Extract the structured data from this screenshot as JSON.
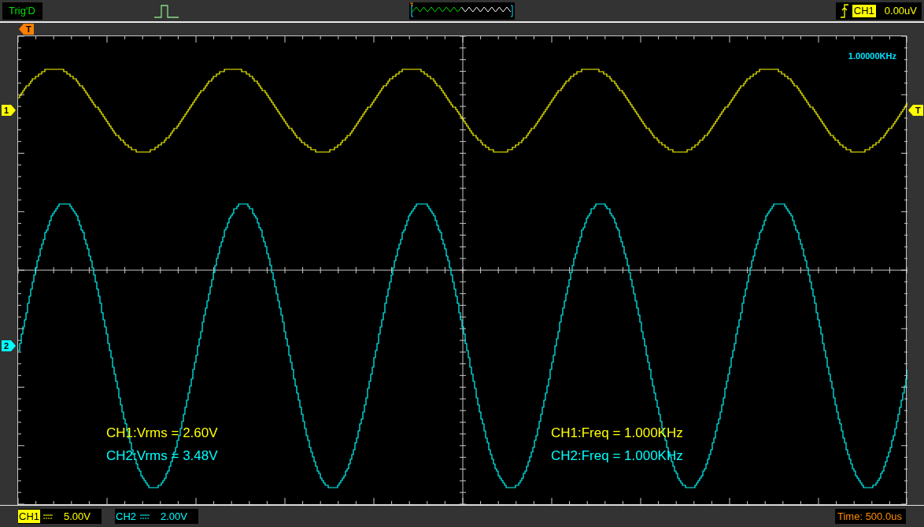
{
  "status": {
    "text": "Trig'D"
  },
  "trigger": {
    "position_marker": "T",
    "level_marker": "T",
    "source": "CH1",
    "level": "0.00uV"
  },
  "frequency_readout": "1.00000KHz",
  "channels": [
    {
      "name": "CH1",
      "marker": "1",
      "color": "#ffff00",
      "scale": "5.00V",
      "selected": true
    },
    {
      "name": "CH2",
      "marker": "2",
      "color": "#00ffff",
      "scale": "2.00V",
      "selected": false
    }
  ],
  "measurements": [
    {
      "text": "CH1:Vrms = 2.60V",
      "color": "#ffff00"
    },
    {
      "text": "CH2:Vrms = 3.48V",
      "color": "#00ffff"
    },
    {
      "text": "CH1:Freq = 1.000KHz",
      "color": "#ffff00"
    },
    {
      "text": "CH2:Freq = 1.000KHz",
      "color": "#00ffff"
    }
  ],
  "timebase": "Time: 500.0us"
}
